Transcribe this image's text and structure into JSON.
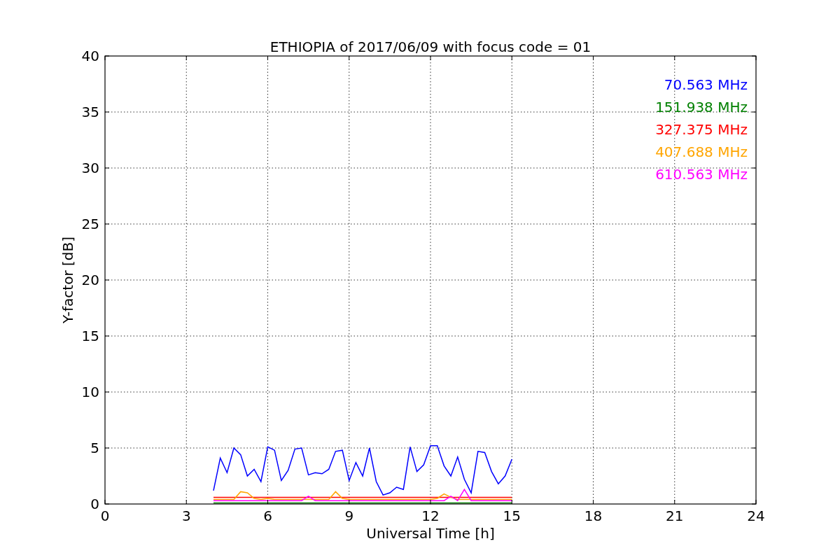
{
  "figure": {
    "chart_data": {
      "type": "line",
      "title": "ETHIOPIA of 2017/06/09 with focus code = 01",
      "xlabel": "Universal Time [h]",
      "ylabel": "Y-factor [dB]",
      "x": [
        4,
        4.25,
        4.5,
        4.75,
        5,
        5.25,
        5.5,
        5.75,
        6,
        6.25,
        6.5,
        6.75,
        7,
        7.25,
        7.5,
        7.75,
        8,
        8.25,
        8.5,
        8.75,
        9,
        9.25,
        9.5,
        9.75,
        10,
        10.25,
        10.5,
        10.75,
        11,
        11.25,
        11.5,
        11.75,
        12,
        12.25,
        12.5,
        12.75,
        13,
        13.25,
        13.5,
        13.75,
        14,
        14.25,
        14.5,
        14.75,
        15
      ],
      "series": [
        {
          "name": "70.563 MHz",
          "color": "#0000ff",
          "values": [
            1.2,
            4.1,
            2.8,
            5.0,
            4.4,
            2.5,
            3.1,
            2.0,
            5.1,
            4.8,
            2.1,
            3.0,
            4.9,
            5.0,
            2.6,
            2.8,
            2.7,
            3.1,
            4.7,
            4.8,
            2.1,
            3.7,
            2.5,
            5.0,
            2.0,
            0.8,
            1.0,
            1.5,
            1.3,
            5.1,
            2.9,
            3.5,
            5.2,
            5.2,
            3.4,
            2.5,
            4.2,
            2.2,
            1.0,
            4.7,
            4.6,
            2.9,
            1.8,
            2.5,
            4.0
          ]
        },
        {
          "name": "151.938 MHz",
          "color": "#008000",
          "values": [
            0.1,
            0.1,
            0.1,
            0.1,
            0.1,
            0.1,
            0.1,
            0.1,
            0.1,
            0.1,
            0.1,
            0.1,
            0.1,
            0.1,
            0.1,
            0.1,
            0.1,
            0.1,
            0.1,
            0.1,
            0.1,
            0.1,
            0.1,
            0.1,
            0.1,
            0.1,
            0.1,
            0.1,
            0.1,
            0.1,
            0.1,
            0.1,
            0.1,
            0.1,
            0.1,
            0.1,
            0.1,
            0.1,
            0.1,
            0.1,
            0.1,
            0.1,
            0.1,
            0.1,
            0.1
          ]
        },
        {
          "name": "327.375 MHz",
          "color": "#ff0000",
          "values": [
            0.6,
            0.6,
            0.6,
            0.6,
            0.6,
            0.6,
            0.6,
            0.6,
            0.6,
            0.6,
            0.6,
            0.6,
            0.6,
            0.6,
            0.6,
            0.6,
            0.6,
            0.6,
            0.6,
            0.6,
            0.6,
            0.6,
            0.6,
            0.6,
            0.6,
            0.6,
            0.6,
            0.6,
            0.6,
            0.6,
            0.6,
            0.6,
            0.6,
            0.6,
            0.6,
            0.6,
            0.6,
            0.6,
            0.6,
            0.6,
            0.6,
            0.6,
            0.6,
            0.6,
            0.6
          ]
        },
        {
          "name": "407.688 MHz",
          "color": "#ffa500",
          "values": [
            0.4,
            0.4,
            0.4,
            0.4,
            1.1,
            1.0,
            0.5,
            0.4,
            0.5,
            0.4,
            0.4,
            0.4,
            0.4,
            0.4,
            0.4,
            0.4,
            0.4,
            0.4,
            1.1,
            0.5,
            0.4,
            0.4,
            0.4,
            0.4,
            0.4,
            0.4,
            0.4,
            0.4,
            0.4,
            0.4,
            0.4,
            0.4,
            0.4,
            0.5,
            0.9,
            0.6,
            0.4,
            0.4,
            0.4,
            0.4,
            0.4,
            0.4,
            0.4,
            0.4,
            0.4
          ]
        },
        {
          "name": "610.563 MHz",
          "color": "#ff00ff",
          "values": [
            0.3,
            0.3,
            0.3,
            0.3,
            0.3,
            0.3,
            0.3,
            0.3,
            0.3,
            0.3,
            0.3,
            0.3,
            0.3,
            0.3,
            0.7,
            0.3,
            0.3,
            0.3,
            0.3,
            0.3,
            0.3,
            0.3,
            0.3,
            0.3,
            0.3,
            0.3,
            0.3,
            0.3,
            0.3,
            0.3,
            0.3,
            0.3,
            0.3,
            0.3,
            0.3,
            0.7,
            0.3,
            1.3,
            0.3,
            0.3,
            0.3,
            0.3,
            0.3,
            0.3,
            0.3
          ]
        }
      ],
      "xlim": [
        0,
        24
      ],
      "ylim": [
        0,
        40
      ],
      "xticks": [
        0,
        3,
        6,
        9,
        12,
        15,
        18,
        21,
        24
      ],
      "yticks": [
        0,
        5,
        10,
        15,
        20,
        25,
        30,
        35,
        40
      ],
      "grid": true
    }
  }
}
